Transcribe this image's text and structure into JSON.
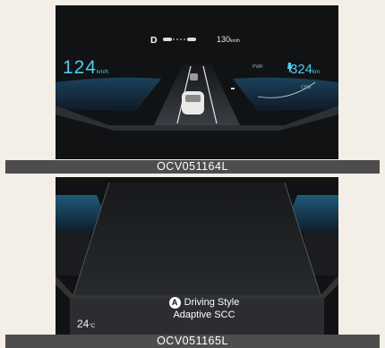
{
  "top_screen": {
    "gear": "D",
    "set_speed": "130",
    "set_speed_unit": "km/h",
    "current_speed": "124",
    "current_speed_unit": "km/h",
    "range": "324",
    "range_unit": "km",
    "gauge_pwr": "PWR",
    "gauge_chg": "CHG"
  },
  "top_caption": "OCV051164L",
  "bottom_screen": {
    "marker": "A",
    "message_line1": "Driving Style",
    "message_line2": "Adaptive SCC",
    "temperature": "24",
    "temperature_unit": "°C"
  },
  "bottom_caption": "OCV051165L"
}
